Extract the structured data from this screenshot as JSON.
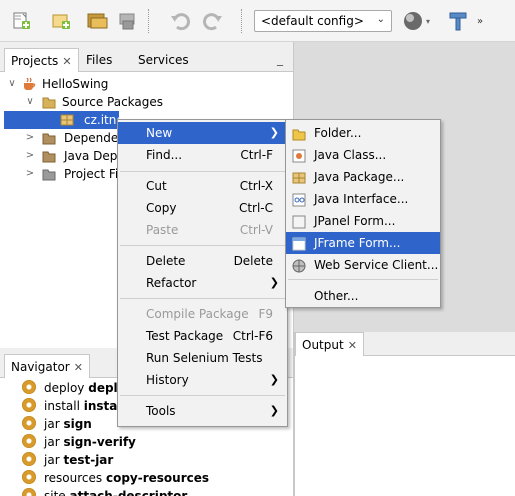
{
  "toolbar": {
    "config_value": "<default config>",
    "icons": [
      "new-file-icon",
      "new-project-icon",
      "open-project-icon",
      "close-project-icon",
      "undo-icon",
      "redo-icon",
      "run-icon",
      "build-icon",
      "more-icon"
    ]
  },
  "projects_panel": {
    "tabs": [
      {
        "label": "Projects",
        "active": true
      },
      {
        "label": "Files",
        "active": false
      },
      {
        "label": "Services",
        "active": false
      }
    ],
    "minimize": "_",
    "tree": [
      {
        "label": "HelloSwing",
        "icon": "coffee-cup-icon",
        "toggle": "∨"
      },
      {
        "label": "Source Packages",
        "icon": "folder-icon",
        "toggle": "∨"
      },
      {
        "label": "cz.itnet...",
        "icon": "package-icon",
        "toggle": "",
        "selected": true
      },
      {
        "label": "Dependencies",
        "icon": "folder-icon",
        "toggle": ">"
      },
      {
        "label": "Java Dependencies",
        "icon": "folder-icon",
        "toggle": ">"
      },
      {
        "label": "Project Files",
        "icon": "folder-icon",
        "toggle": ">"
      }
    ]
  },
  "navigator": {
    "tab_label": "Navigator",
    "items": [
      {
        "prefix": "deploy",
        "target": "deploy"
      },
      {
        "prefix": "install",
        "target": "install-..."
      },
      {
        "prefix": "jar",
        "target": "sign"
      },
      {
        "prefix": "jar",
        "target": "sign-verify"
      },
      {
        "prefix": "jar",
        "target": "test-jar"
      },
      {
        "prefix": "resources",
        "target": "copy-resources"
      },
      {
        "prefix": "site",
        "target": "attach-descriptor"
      }
    ]
  },
  "output_tab": {
    "label": "Output"
  },
  "context_menu": {
    "items": [
      {
        "label": "New",
        "shortcut": "",
        "submenu": true,
        "highlight": true
      },
      {
        "label": "Find...",
        "shortcut": "Ctrl-F"
      },
      {
        "label": "Cut",
        "shortcut": "Ctrl-X"
      },
      {
        "label": "Copy",
        "shortcut": "Ctrl-C"
      },
      {
        "label": "Paste",
        "shortcut": "Ctrl-V",
        "disabled": true
      },
      {
        "label": "Delete",
        "shortcut": "Delete"
      },
      {
        "label": "Refactor",
        "shortcut": "",
        "submenu": true
      },
      {
        "label": "Compile Package",
        "shortcut": "F9",
        "disabled": true
      },
      {
        "label": "Test Package",
        "shortcut": "Ctrl-F6"
      },
      {
        "label": "Run Selenium Tests",
        "shortcut": ""
      },
      {
        "label": "History",
        "shortcut": "",
        "submenu": true
      },
      {
        "label": "Tools",
        "shortcut": "",
        "submenu": true
      }
    ]
  },
  "new_submenu": {
    "items": [
      {
        "label": "Folder...",
        "icon": "folder-icon"
      },
      {
        "label": "Java Class...",
        "icon": "java-class-icon"
      },
      {
        "label": "Java Package...",
        "icon": "package-icon"
      },
      {
        "label": "Java Interface...",
        "icon": "interface-icon"
      },
      {
        "label": "JPanel Form...",
        "icon": "jpanel-icon"
      },
      {
        "label": "JFrame Form...",
        "icon": "jframe-icon",
        "highlight": true
      },
      {
        "label": "Web Service Client...",
        "icon": "web-service-icon"
      },
      {
        "label": "Other...",
        "icon": ""
      }
    ]
  }
}
